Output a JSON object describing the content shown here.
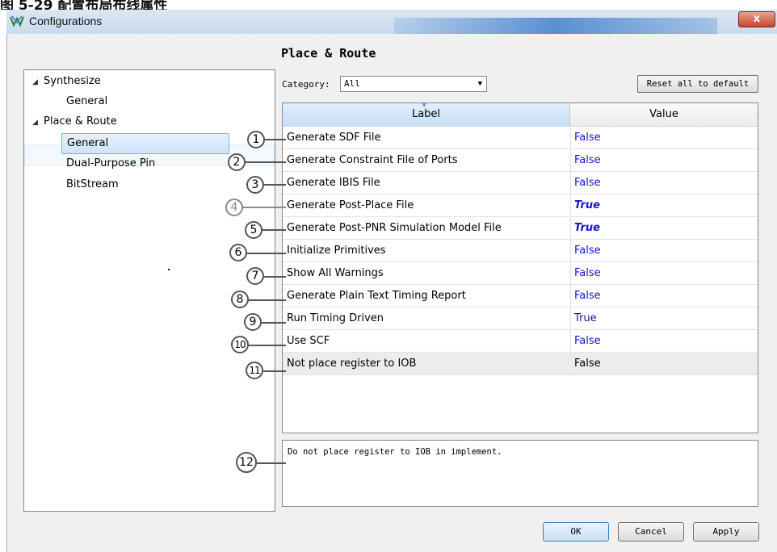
{
  "caption": "图 5-29 配置布局布线属性",
  "window": {
    "title": "Configurations",
    "close_label": "x"
  },
  "tree": {
    "items": [
      {
        "label": "Synthesize",
        "expanded": true
      },
      {
        "label": "General"
      },
      {
        "label": "Place & Route",
        "expanded": true
      },
      {
        "label": "General",
        "selected": true
      },
      {
        "label": "Dual-Purpose Pin"
      },
      {
        "label": "BitStream"
      }
    ],
    "arrow": "◢"
  },
  "section_title": "Place & Route",
  "category": {
    "label": "Category:",
    "value": "All",
    "dropdown_icon": "▼"
  },
  "reset_button": "Reset all to default",
  "table": {
    "columns": [
      "Label",
      "Value"
    ],
    "sort_icon": "▼",
    "rows": [
      {
        "label": "Generate SDF File",
        "value": "False"
      },
      {
        "label": "Generate Constraint File of Ports",
        "value": "False"
      },
      {
        "label": "Generate IBIS File",
        "value": "False"
      },
      {
        "label": "Generate Post-Place File",
        "value": "True"
      },
      {
        "label": "Generate Post-PNR Simulation Model File",
        "value": "True"
      },
      {
        "label": "Initialize Primitives",
        "value": "False"
      },
      {
        "label": "Show All Warnings",
        "value": "False"
      },
      {
        "label": "Generate Plain Text Timing Report",
        "value": "False"
      },
      {
        "label": "Run Timing Driven",
        "value": "True"
      },
      {
        "label": "Use SCF",
        "value": "False"
      },
      {
        "label": "Not place register to IOB",
        "value": "False"
      }
    ]
  },
  "description": "Do not place register to IOB in implement.",
  "callouts": [
    "1",
    "2",
    "3",
    "4",
    "5",
    "6",
    "7",
    "8",
    "9",
    "10",
    "11",
    "12"
  ],
  "buttons": {
    "ok": "OK",
    "cancel": "Cancel",
    "apply": "Apply"
  },
  "colors": {
    "value_blue": "#1616c8",
    "selection_blue": "#cde4fb",
    "titlebar": "#dbe7f4"
  }
}
